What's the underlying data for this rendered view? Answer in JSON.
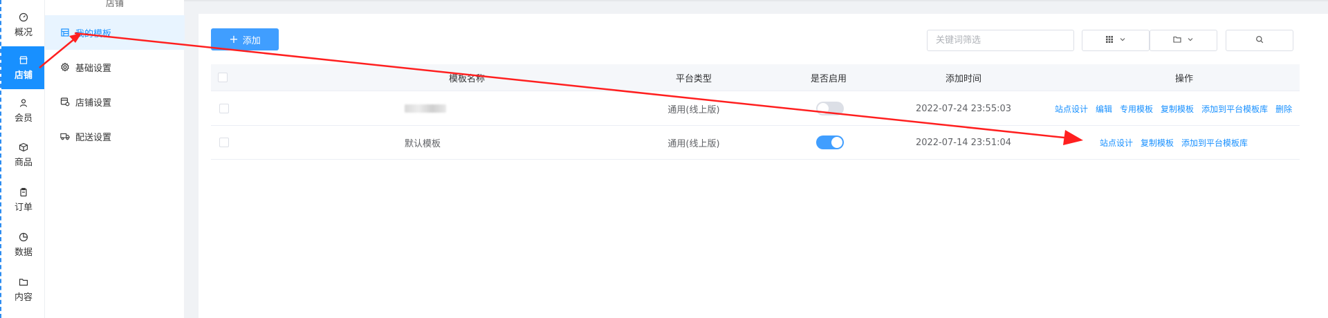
{
  "rail": {
    "items": [
      {
        "label": "概况",
        "icon": "dashboard-icon"
      },
      {
        "label": "店铺",
        "icon": "store-icon"
      },
      {
        "label": "会员",
        "icon": "member-icon"
      },
      {
        "label": "商品",
        "icon": "box-icon"
      },
      {
        "label": "订单",
        "icon": "clipboard-icon"
      },
      {
        "label": "数据",
        "icon": "pie-chart-icon"
      },
      {
        "label": "内容",
        "icon": "folder-icon"
      }
    ],
    "active_index": 1
  },
  "sidebar": {
    "title": "店铺",
    "items": [
      {
        "label": "我的模板",
        "icon": "template-icon"
      },
      {
        "label": "基础设置",
        "icon": "gear-icon"
      },
      {
        "label": "店铺设置",
        "icon": "store-settings-icon"
      },
      {
        "label": "配送设置",
        "icon": "truck-icon"
      }
    ],
    "active_index": 0
  },
  "toolbar": {
    "add_label": "添加",
    "search_placeholder": "关键词筛选",
    "grid_icon": "grid-icon",
    "folder_icon": "folder-icon",
    "search_icon": "search-icon"
  },
  "table": {
    "columns": [
      "模板名称",
      "平台类型",
      "是否启用",
      "添加时间",
      "操作"
    ],
    "rows": [
      {
        "name": "",
        "platform": "通用(线上版)",
        "enabled": false,
        "time": "2022-07-24 23:55:03",
        "actions": [
          "站点设计",
          "编辑",
          "专用模板",
          "复制模板",
          "添加到平台模板库",
          "删除"
        ]
      },
      {
        "name": "默认模板",
        "platform": "通用(线上版)",
        "enabled": true,
        "time": "2022-07-14 23:51:04",
        "actions": [
          "站点设计",
          "复制模板",
          "添加到平台模板库"
        ]
      }
    ]
  },
  "colors": {
    "accent": "#1890ff",
    "button": "#409eff",
    "annotation": "#ff1f1f"
  }
}
